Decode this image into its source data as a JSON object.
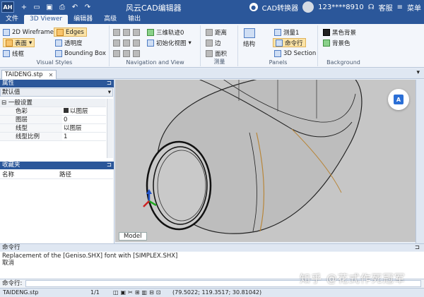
{
  "app": {
    "logo": "AH",
    "title": "风云CAD编辑器"
  },
  "header": {
    "converter": "CAD转换器",
    "phone": "123****8910",
    "service": "客服",
    "menu": "菜单"
  },
  "menus": [
    "文件",
    "3D Viewer",
    "编辑器",
    "高级",
    "输出"
  ],
  "ribbon": {
    "visual": {
      "wireframe": "2D Wireframe",
      "surface": "表面",
      "line": "线框",
      "edges": "Edges",
      "transparency": "透明度",
      "bbox": "Bounding Box",
      "label": "Visual Styles"
    },
    "nav": {
      "orbit": "三维轨迹0",
      "init_view": "初始化视图",
      "label": "Navigation and View"
    },
    "measure": {
      "distance": "距离",
      "edge": "边",
      "area": "面积",
      "label": "测量"
    },
    "panels": {
      "structure": "结构",
      "m1": "测量1",
      "cmd": "命令行",
      "section": "3D Section",
      "label": "Panels"
    },
    "background": {
      "black": "黑色背景",
      "color": "背景色",
      "label": "Background"
    }
  },
  "doc_tab": "TAIDENG.stp",
  "props": {
    "header": "属性",
    "dropdown": "默认值",
    "category": "一般设置",
    "rows": [
      {
        "k": "色彩",
        "v": "以图层"
      },
      {
        "k": "图层",
        "v": "0"
      },
      {
        "k": "线型",
        "v": "以图层"
      },
      {
        "k": "线型比例",
        "v": "1"
      }
    ]
  },
  "fav": {
    "header": "收藏夹",
    "col_name": "名称",
    "col_path": "路径"
  },
  "viewport": {
    "model_tab": "Model"
  },
  "cmd": {
    "header": "命令行",
    "line1": "Replacement of the [Geniso.SHX] font with [SIMPLEX.SHX]",
    "line2": "取消",
    "prompt": "命令行:"
  },
  "status": {
    "file": "TAIDENG.stp",
    "page": "1/1",
    "coords": "(79.5022; 119.3517; 30.81042)"
  },
  "watermark": "知乎 @花式作死冠军",
  "colors": {
    "accent": "#2b579a",
    "viewport": "#c6c6c6"
  }
}
